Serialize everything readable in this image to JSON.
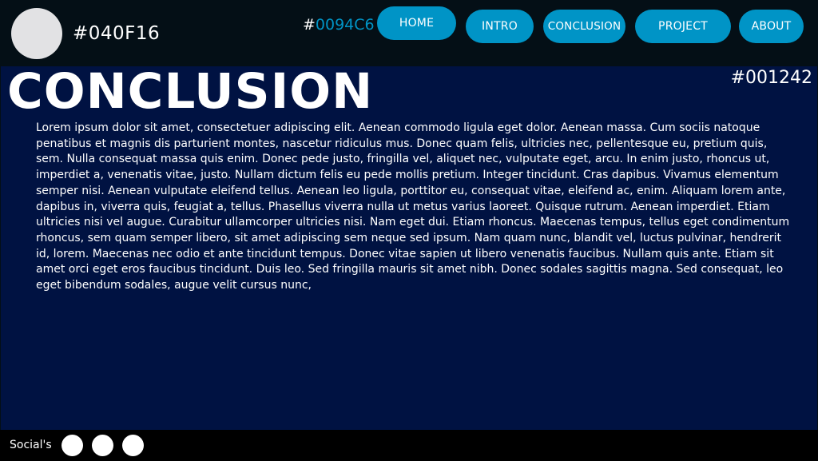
{
  "header": {
    "hex_left": "#040F16",
    "hex_accent_prefix": "#",
    "hex_accent_value": "0094C6",
    "nav": {
      "home": "HOME",
      "intro": "INTRO",
      "conclusion": "CONCLUSION",
      "project": "PROJECT",
      "about": "ABOUT"
    }
  },
  "main": {
    "title": "CONCLUSION",
    "hex_right": "#001242",
    "body": "Lorem ipsum dolor sit amet, consectetuer adipiscing elit. Aenean commodo ligula eget dolor. Aenean massa. Cum sociis natoque penatibus et magnis dis parturient montes, nascetur ridiculus mus. Donec quam felis, ultricies nec, pellentesque eu, pretium quis, sem. Nulla consequat massa quis enim. Donec pede justo, fringilla vel, aliquet nec, vulputate eget, arcu. In enim justo, rhoncus ut, imperdiet a, venenatis vitae, justo. Nullam dictum felis eu pede mollis pretium. Integer tincidunt. Cras dapibus. Vivamus elementum semper nisi. Aenean vulputate eleifend tellus. Aenean leo ligula, porttitor eu, consequat vitae, eleifend ac, enim. Aliquam lorem ante, dapibus in, viverra quis, feugiat a, tellus. Phasellus viverra nulla ut metus varius laoreet. Quisque rutrum. Aenean imperdiet. Etiam ultricies nisi vel augue. Curabitur ullamcorper ultricies nisi. Nam eget dui. Etiam rhoncus. Maecenas tempus, tellus eget condimentum rhoncus, sem quam semper libero, sit amet adipiscing sem neque sed ipsum. Nam quam nunc, blandit vel, luctus pulvinar, hendrerit id, lorem. Maecenas nec odio et ante tincidunt tempus. Donec vitae sapien ut libero venenatis faucibus. Nullam quis ante. Etiam sit amet orci eget eros faucibus tincidunt. Duis leo. Sed fringilla mauris sit amet nibh. Donec sodales sagittis magna. Sed consequat, leo eget bibendum sodales, augue velit cursus nunc,"
  },
  "footer": {
    "socials_label": "Social's"
  },
  "colors": {
    "header_bg": "#040F16",
    "accent": "#0094C6",
    "main_bg": "#001242"
  }
}
